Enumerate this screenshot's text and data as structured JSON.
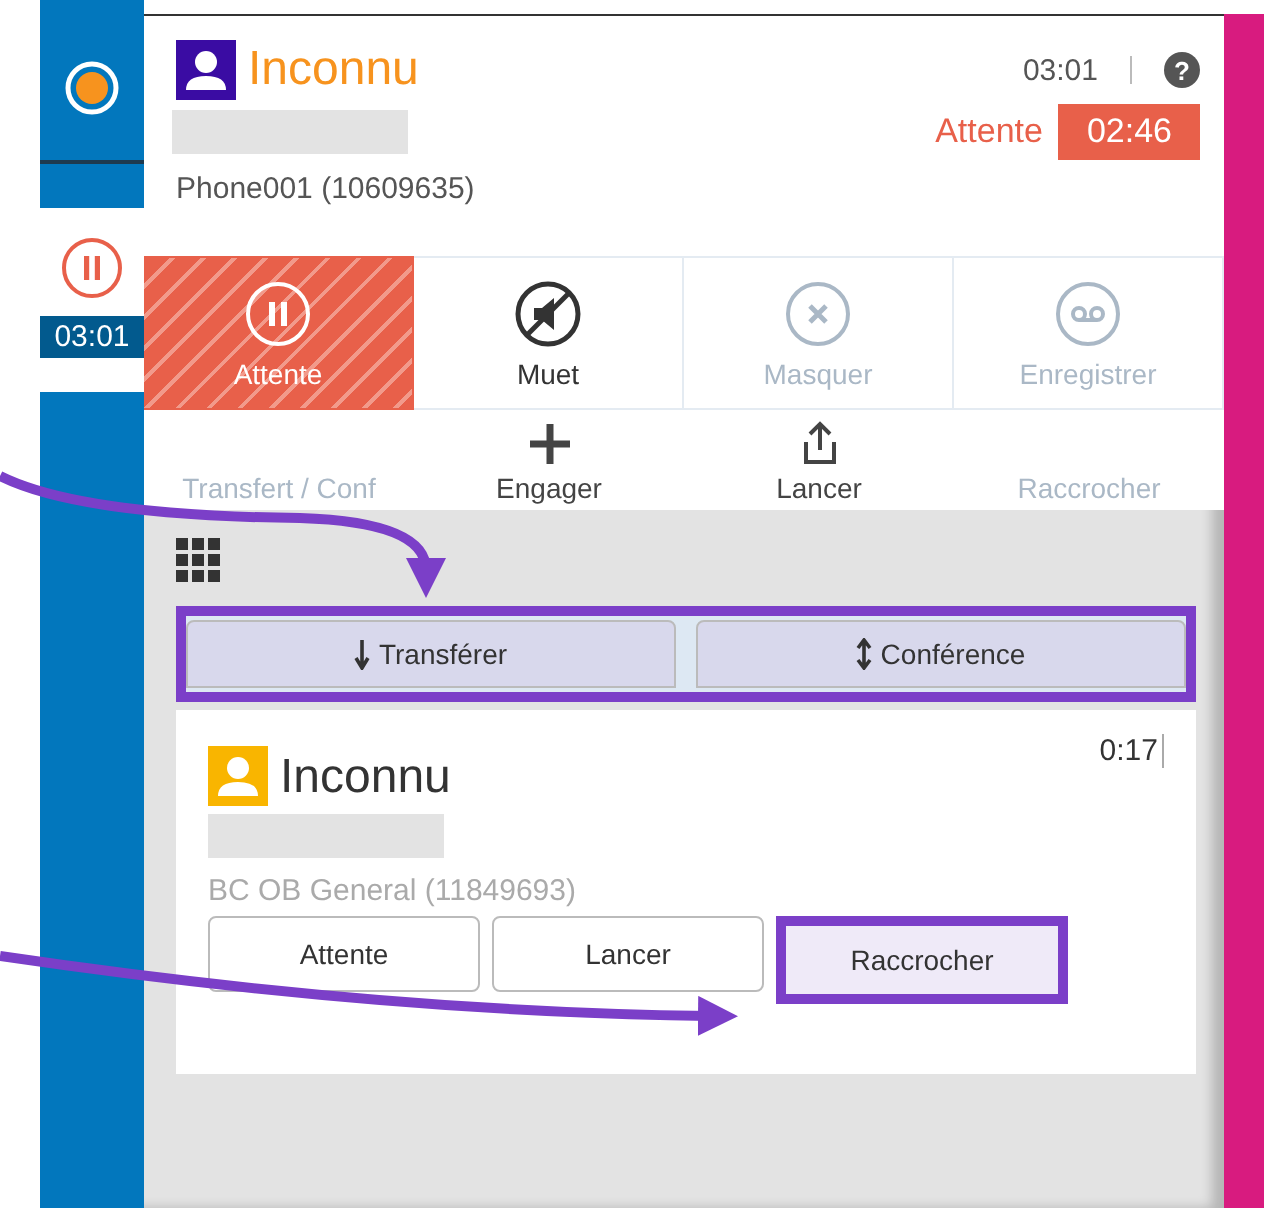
{
  "sidebar": {
    "call_timer": "03:01"
  },
  "header": {
    "caller": "Inconnu",
    "elapsed": "03:01",
    "help": "?",
    "status": {
      "label": "Attente",
      "timer": "02:46"
    },
    "line": "Phone001 (10609635)"
  },
  "actions": [
    {
      "label": "Attente",
      "selected": true,
      "disabled": false
    },
    {
      "label": "Muet",
      "selected": false,
      "disabled": false
    },
    {
      "label": "Masquer",
      "selected": false,
      "disabled": true
    },
    {
      "label": "Enregistrer",
      "selected": false,
      "disabled": true
    },
    {
      "label": "Transfert / Conf",
      "selected": false,
      "disabled": true
    },
    {
      "label": "Engager",
      "selected": false,
      "disabled": false
    },
    {
      "label": "Lancer",
      "selected": false,
      "disabled": false
    },
    {
      "label": "Raccrocher",
      "selected": false,
      "disabled": true
    }
  ],
  "transfer": {
    "highlighted": true,
    "buttons": [
      {
        "label": "Transférer"
      },
      {
        "label": "Conférence"
      }
    ]
  },
  "card": {
    "caller": "Inconnu",
    "timer": "0:17",
    "line": "BC OB General (11849693)",
    "buttons": [
      {
        "label": "Attente",
        "highlighted": false
      },
      {
        "label": "Lancer",
        "highlighted": false
      },
      {
        "label": "Raccrocher",
        "highlighted": true
      }
    ]
  }
}
